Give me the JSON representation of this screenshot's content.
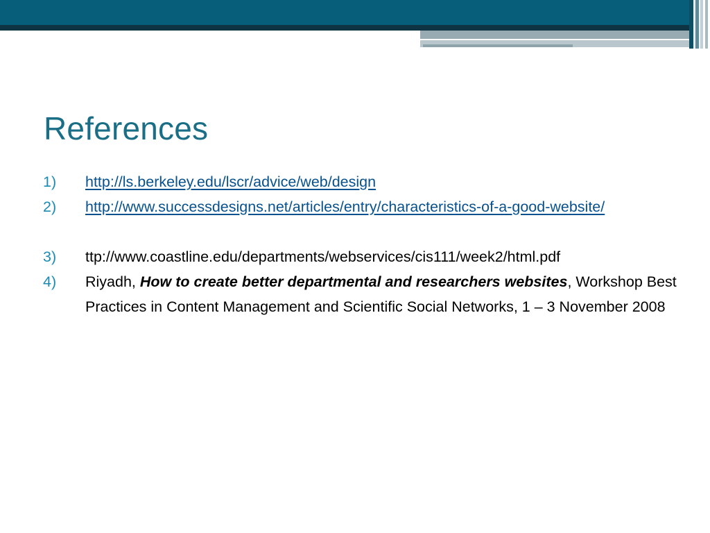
{
  "slide": {
    "title": "References",
    "colors": {
      "band": "#065e7a",
      "title": "#1a6e86",
      "number": "#1a8bb4",
      "link": "#06518e",
      "text": "#000000"
    }
  },
  "references": [
    {
      "number": "1)",
      "link": "http://ls.berkeley.edu/lscr/advice/web/design"
    },
    {
      "number": "2)",
      "link": "http://www.successdesigns.net/articles/entry/characteristics-of-a-good-website/"
    },
    {
      "number": "3)",
      "text": "ttp://www.coastline.edu/departments/webservices/cis111/week2/html.pdf"
    },
    {
      "number": "4)",
      "prefix": "Riyadh, ",
      "emphasis": "How to create better departmental and researchers websites",
      "suffix": ", Workshop Best Practices in Content Management and Scientific Social Networks, 1 – 3 November 2008"
    }
  ]
}
